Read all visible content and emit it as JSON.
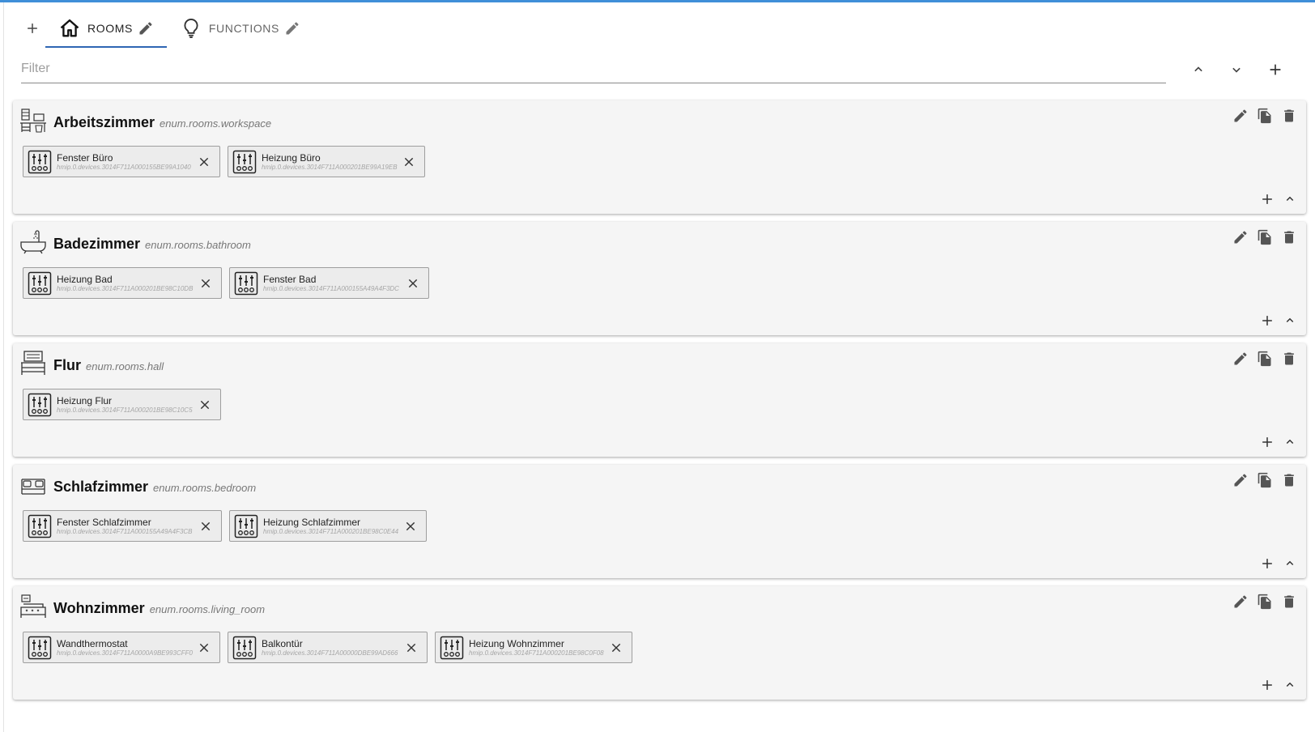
{
  "tabs": [
    {
      "label": "ROOMS",
      "icon": "home-icon",
      "active": true
    },
    {
      "label": "FUNCTIONS",
      "icon": "lightbulb-icon",
      "active": false
    }
  ],
  "filter": {
    "placeholder": "Filter",
    "value": ""
  },
  "colors": {
    "accent": "#3f8fd8",
    "tab_underline": "#2f66b4",
    "card_bg": "#f5f5f5",
    "chip_bg": "#ececec"
  },
  "rooms": [
    {
      "name": "Arbeitszimmer",
      "id": "enum.rooms.workspace",
      "icon": "desk-icon",
      "members": [
        {
          "name": "Fenster Büro",
          "id": "hmip.0.devices.3014F711A000155BE99A1040"
        },
        {
          "name": "Heizung Büro",
          "id": "hmip.0.devices.3014F711A000201BE99A19EB"
        }
      ]
    },
    {
      "name": "Badezimmer",
      "id": "enum.rooms.bathroom",
      "icon": "bathtub-icon",
      "members": [
        {
          "name": "Heizung Bad",
          "id": "hmip.0.devices.3014F711A000201BE98C10DB"
        },
        {
          "name": "Fenster Bad",
          "id": "hmip.0.devices.3014F711A000155A49A4F3DC"
        }
      ]
    },
    {
      "name": "Flur",
      "id": "enum.rooms.hall",
      "icon": "hall-icon",
      "members": [
        {
          "name": "Heizung Flur",
          "id": "hmip.0.devices.3014F711A000201BE98C10C5"
        }
      ]
    },
    {
      "name": "Schlafzimmer",
      "id": "enum.rooms.bedroom",
      "icon": "bed-icon",
      "members": [
        {
          "name": "Fenster Schlafzimmer",
          "id": "hmip.0.devices.3014F711A000155A49A4F3CB"
        },
        {
          "name": "Heizung Schlafzimmer",
          "id": "hmip.0.devices.3014F711A000201BE98C0E44"
        }
      ]
    },
    {
      "name": "Wohnzimmer",
      "id": "enum.rooms.living_room",
      "icon": "sofa-icon",
      "members": [
        {
          "name": "Wandthermostat",
          "id": "hmip.0.devices.3014F711A0000A9BE993CFF0"
        },
        {
          "name": "Balkontür",
          "id": "hmip.0.devices.3014F711A00000DBE99AD666"
        },
        {
          "name": "Heizung Wohnzimmer",
          "id": "hmip.0.devices.3014F711A000201BE98C0F08"
        }
      ]
    }
  ]
}
